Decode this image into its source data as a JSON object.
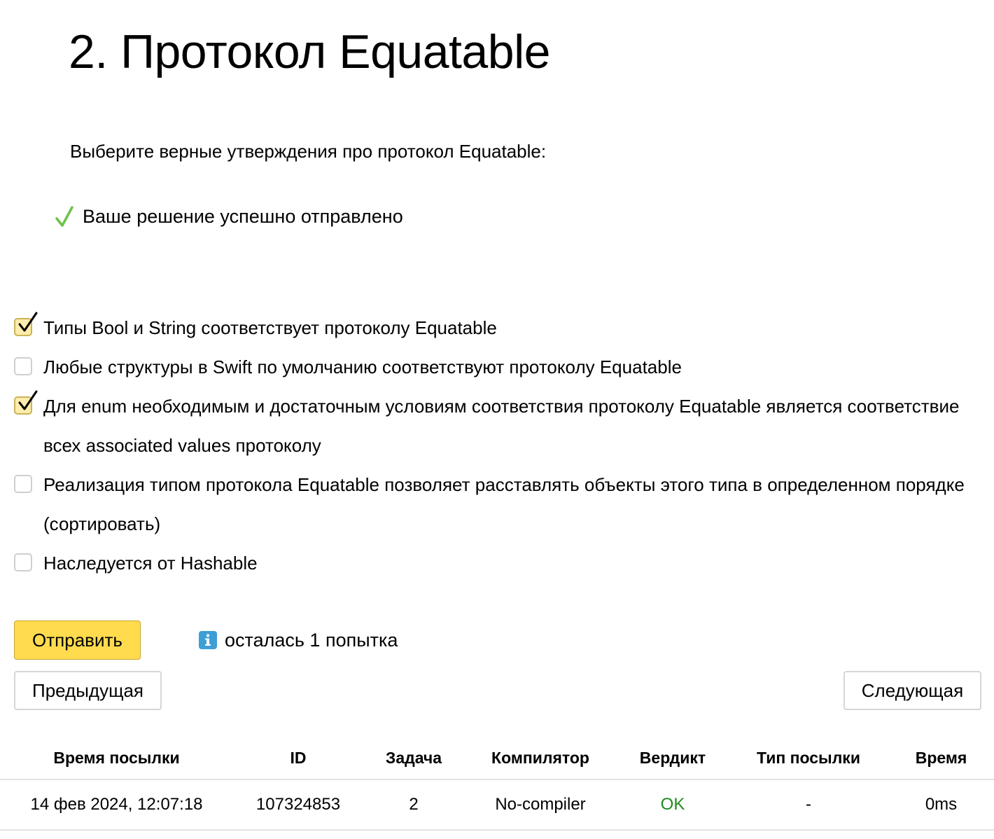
{
  "page": {
    "title": "2. Протокол Equatable",
    "question": "Выберите верные утверждения про протокол Equatable:",
    "success_message": "Ваше решение успешно отправлено"
  },
  "options": [
    {
      "label": "Типы Bool и String соответствует протоколу Equatable",
      "checked": true
    },
    {
      "label": "Любые структуры в Swift по умолчанию соответствуют протоколу Equatable",
      "checked": false
    },
    {
      "label": "Для enum необходимым и достаточным условиям соответствия протоколу Equatable является соответствие всех associated values протоколу",
      "checked": true
    },
    {
      "label": "Реализация типом протокола Equatable позволяет расставлять объекты этого типа в определенном порядке (сортировать)",
      "checked": false
    },
    {
      "label": "Наследуется от Hashable",
      "checked": false
    }
  ],
  "actions": {
    "submit_label": "Отправить",
    "attempts_text": "осталась 1 попытка",
    "prev_label": "Предыдущая",
    "next_label": "Следующая"
  },
  "submissions": {
    "columns": [
      "Время посылки",
      "ID",
      "Задача",
      "Компилятор",
      "Вердикт",
      "Тип посылки",
      "Время"
    ],
    "rows": [
      {
        "time": "14 фев 2024, 12:07:18",
        "id": "107324853",
        "task": "2",
        "compiler": "No-compiler",
        "verdict": "OK",
        "type": "-",
        "duration": "0ms"
      }
    ]
  },
  "colors": {
    "submit_button": "#ffdb4d",
    "success_check": "#6cc24a",
    "verdict_ok": "#1f8a1f",
    "info_icon": "#3d9fd6",
    "checked_box": "#fdecaa"
  }
}
